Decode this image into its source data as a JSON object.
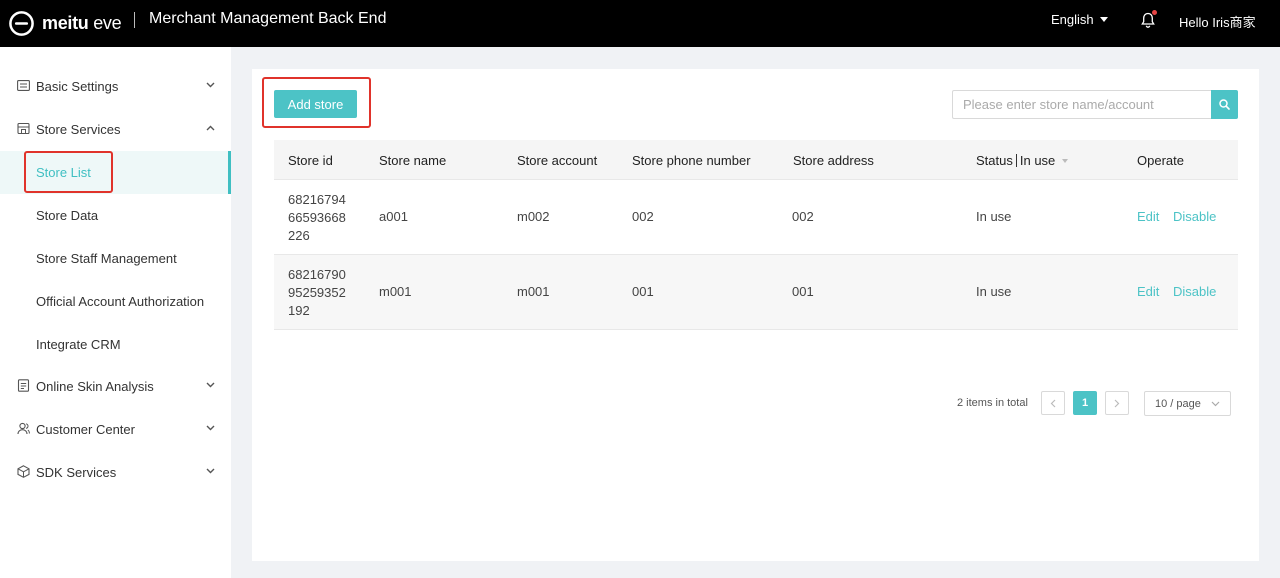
{
  "header": {
    "logo_text_bold": "meitu",
    "logo_text_light": "eve",
    "app_title": "Merchant Management Back End",
    "language": "English",
    "greeting": "Hello Iris商家"
  },
  "sidebar": {
    "items": [
      {
        "label": "Basic Settings",
        "icon": "settings-panel-icon",
        "expanded": false
      },
      {
        "label": "Store Services",
        "icon": "store-icon",
        "expanded": true,
        "children": [
          {
            "label": "Store List",
            "active": true
          },
          {
            "label": "Store Data"
          },
          {
            "label": "Store Staff Management"
          },
          {
            "label": "Official Account Authorization"
          },
          {
            "label": "Integrate CRM"
          }
        ]
      },
      {
        "label": "Online Skin Analysis",
        "icon": "document-icon",
        "expanded": false
      },
      {
        "label": "Customer Center",
        "icon": "users-icon",
        "expanded": false
      },
      {
        "label": "SDK Services",
        "icon": "cube-icon",
        "expanded": false
      }
    ]
  },
  "toolbar": {
    "add_store_label": "Add store",
    "search_placeholder": "Please enter store name/account"
  },
  "table": {
    "columns": [
      "Store id",
      "Store name",
      "Store account",
      "Store phone number",
      "Store address",
      "Status",
      "In use",
      "Operate"
    ],
    "rows": [
      {
        "id_lines": [
          "68216794",
          "66593668",
          "226"
        ],
        "name": "a001",
        "account": "m002",
        "phone": "002",
        "address": "002",
        "status": "In use",
        "edit": "Edit",
        "disable": "Disable"
      },
      {
        "id_lines": [
          "68216790",
          "95259352",
          "192"
        ],
        "name": "m001",
        "account": "m001",
        "phone": "001",
        "address": "001",
        "status": "In use",
        "edit": "Edit",
        "disable": "Disable"
      }
    ]
  },
  "pagination": {
    "total_text": "2 items in total",
    "current_page": "1",
    "page_size_label": "10 / page"
  },
  "colors": {
    "accent": "#4cc3c6",
    "highlight_box": "#e0332b",
    "header_bg": "#000000"
  }
}
